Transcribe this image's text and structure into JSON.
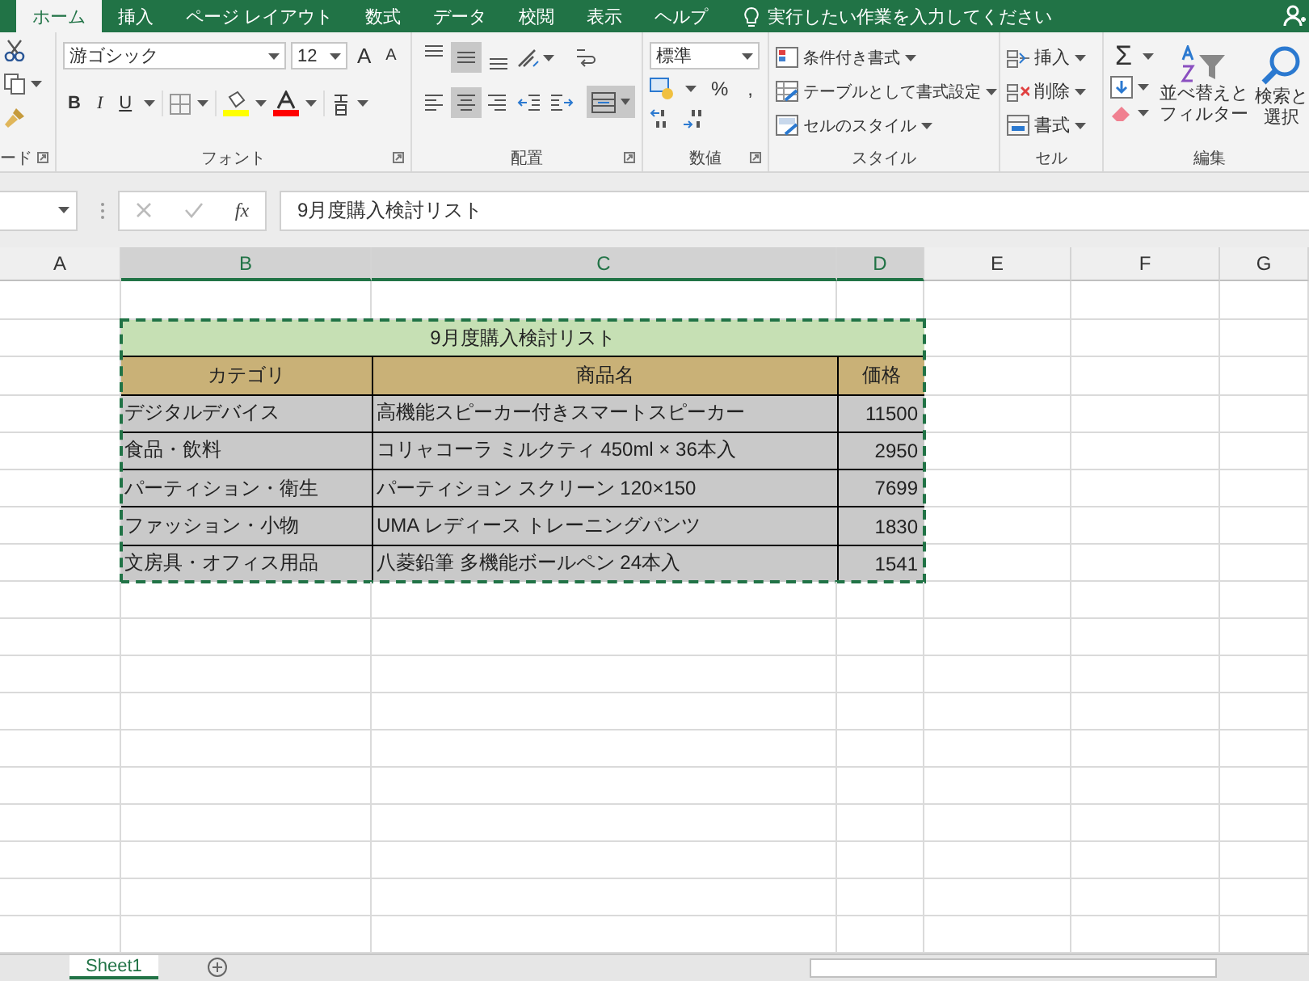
{
  "ribbon_tabs": [
    {
      "label": "ホーム",
      "selected": true
    },
    {
      "label": "挿入",
      "selected": false
    },
    {
      "label": "ページ レイアウト",
      "selected": false
    },
    {
      "label": "数式",
      "selected": false
    },
    {
      "label": "データ",
      "selected": false
    },
    {
      "label": "校閲",
      "selected": false
    },
    {
      "label": "表示",
      "selected": false
    },
    {
      "label": "ヘルプ",
      "selected": false
    }
  ],
  "tell_me": {
    "placeholder": "実行したい作業を入力してください"
  },
  "clipboard": {
    "label": "ード"
  },
  "font": {
    "label": "フォント",
    "font_name": "游ゴシック",
    "font_size": "12",
    "grow": "A",
    "shrink": "A",
    "bold": "B",
    "italic": "I",
    "underline": "U"
  },
  "alignment": {
    "label": "配置",
    "top_row": [
      {
        "kind": "top",
        "on": false
      },
      {
        "kind": "middle",
        "on": true
      },
      {
        "kind": "bottom",
        "on": false
      }
    ],
    "bottom_row": [
      {
        "kind": "left",
        "on": false
      },
      {
        "kind": "center",
        "on": true
      },
      {
        "kind": "right",
        "on": false
      },
      {
        "kind": "outdent",
        "on": false
      },
      {
        "kind": "indent",
        "on": false
      }
    ],
    "merge_on": true
  },
  "number": {
    "label": "数値",
    "format": "標準",
    "percent": "%",
    "comma": ","
  },
  "styles": {
    "label": "スタイル",
    "items": [
      "条件付き書式",
      "テーブルとして書式設定",
      "セルのスタイル"
    ]
  },
  "cells": {
    "label": "セル",
    "items": [
      "挿入",
      "削除",
      "書式"
    ]
  },
  "editing": {
    "label": "編集",
    "sum": "Σ",
    "sort": [
      "並べ替えと",
      "フィルター"
    ],
    "find": [
      "検索と",
      "選択"
    ]
  },
  "formula_bar": {
    "fx": "fx",
    "value": "9月度購入検討リスト"
  },
  "columns": [
    {
      "label": "A",
      "selected": false
    },
    {
      "label": "B",
      "selected": true
    },
    {
      "label": "C",
      "selected": true
    },
    {
      "label": "D",
      "selected": true
    },
    {
      "label": "E",
      "selected": false
    },
    {
      "label": "F",
      "selected": false
    },
    {
      "label": "G",
      "selected": false
    }
  ],
  "table": {
    "title": "9月度購入検討リスト",
    "headers": [
      "カテゴリ",
      "商品名",
      "価格"
    ],
    "rows": [
      [
        "デジタルデバイス",
        "高機能スピーカー付きスマートスピーカー",
        "11500"
      ],
      [
        "食品・飲料",
        "コリャコーラ ミルクティ 450ml × 36本入",
        "2950"
      ],
      [
        "パーティション・衛生",
        "パーティション スクリーン 120×150",
        "7699"
      ],
      [
        "ファッション・小物",
        "UMA レディース トレーニングパンツ",
        "1830"
      ],
      [
        "文房具・オフィス用品",
        "八菱鉛筆 多機能ボールペン 24本入",
        "1541"
      ]
    ]
  },
  "sheet_tabs": [
    {
      "label": "Sheet1",
      "selected": true
    }
  ]
}
